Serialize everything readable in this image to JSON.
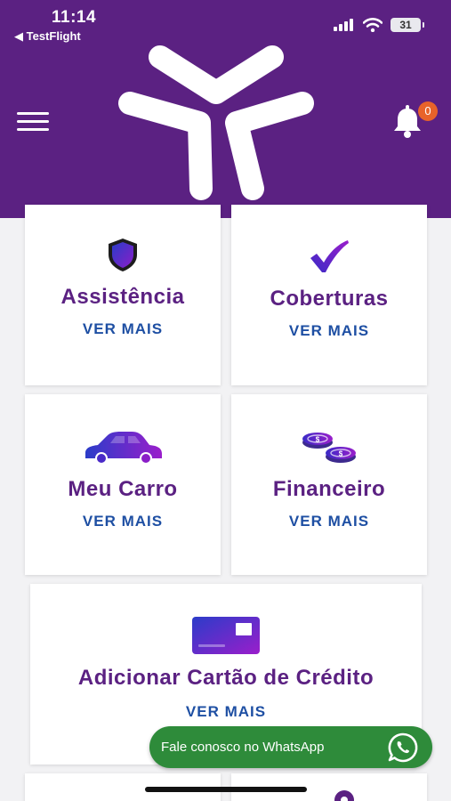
{
  "status_bar": {
    "time": "11:14",
    "back_app": "◀ TestFlight",
    "battery": "31"
  },
  "header": {
    "notification_count": "0",
    "colors": {
      "brand": "#5b2182",
      "badge": "#e8632a"
    }
  },
  "cards": [
    {
      "title": "Assistência",
      "link": "VER MAIS",
      "icon": "shield-icon"
    },
    {
      "title": "Coberturas",
      "link": "VER MAIS",
      "icon": "checkmark-icon"
    },
    {
      "title": "Meu Carro",
      "link": "VER MAIS",
      "icon": "car-icon"
    },
    {
      "title": "Financeiro",
      "link": "VER MAIS",
      "icon": "coins-icon"
    },
    {
      "title": "Adicionar Cartão de Crédito",
      "link": "VER MAIS",
      "icon": "credit-card-icon"
    }
  ],
  "whatsapp": {
    "label": "Fale conosco no WhatsApp",
    "color": "#2e8b3a"
  },
  "colors": {
    "card_title": "#5b2182",
    "card_link": "#1e4fa3"
  }
}
